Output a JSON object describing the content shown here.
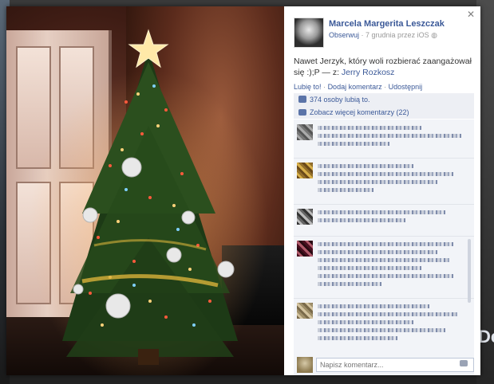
{
  "post": {
    "author": "Marcela Margerita Leszczak",
    "follow_label": "Obserwuj",
    "meta": "· 7 grudnia przez iOS",
    "caption_text": "Nawet Jerzyk, który woli rozbierać zaangażował się :);P — z:",
    "caption_tag": "Jerry Rozkosz"
  },
  "actions": {
    "like": "Lubię to!",
    "comment": "Dodaj komentarz",
    "share": "Udostępnij",
    "sep": "·"
  },
  "likes": {
    "count_text": "374 osoby lubią to.",
    "more_comments": "Zobacz więcej komentarzy (22)"
  },
  "composer": {
    "placeholder": "Napisz komentarz..."
  },
  "background": {
    "right_text": "De"
  },
  "colors": {
    "link": "#3b5998",
    "panel_bg": "#ffffff",
    "likes_bg": "#edeff4"
  },
  "icons": {
    "close": "close-icon",
    "like": "thumbs-up-icon",
    "comments": "comment-bubble-icon",
    "camera": "camera-icon",
    "globe": "globe-icon"
  }
}
